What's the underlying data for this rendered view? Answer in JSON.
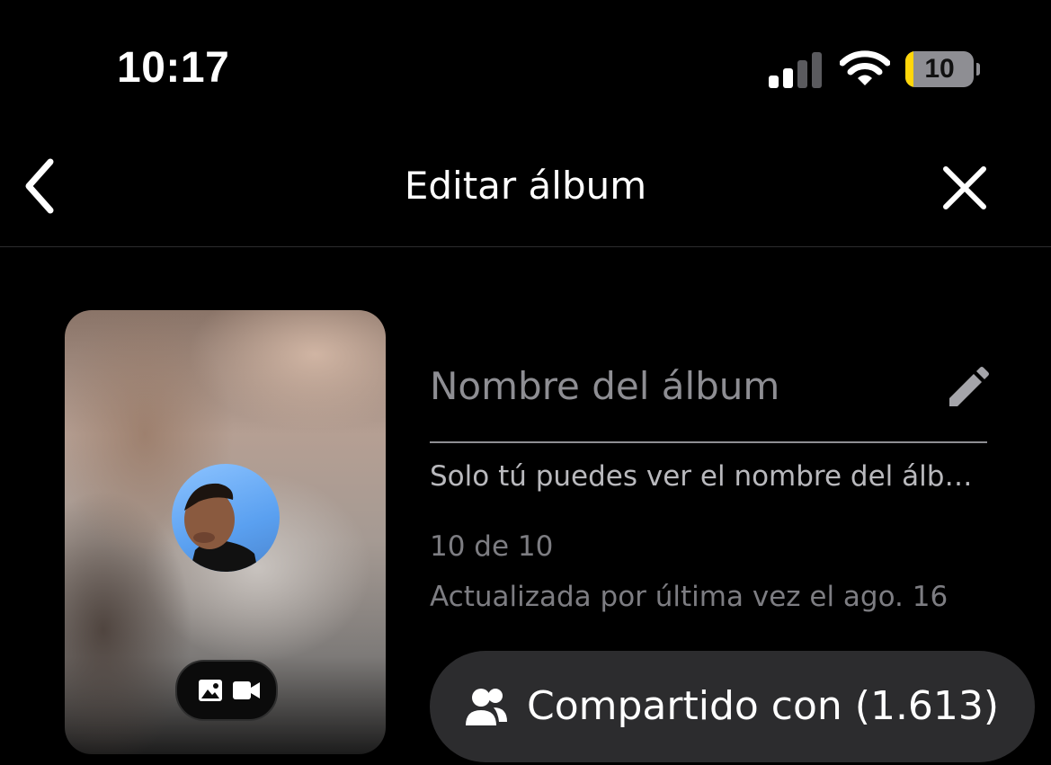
{
  "status_bar": {
    "time": "10:17",
    "battery_level": "10",
    "battery_fraction": 0.1,
    "battery_color": "#ffd60a",
    "icons": [
      "cellular-signal-icon",
      "wifi-icon",
      "battery-icon"
    ]
  },
  "nav": {
    "title": "Editar álbum",
    "back_icon": "chevron-left-icon",
    "close_icon": "close-icon"
  },
  "album": {
    "name_placeholder": "Nombre del álbum",
    "edit_icon": "pencil-icon",
    "privacy_note": "Solo tú puedes ver el nombre del álbum",
    "count": "10 de 10",
    "updated": "Actualizada por última vez el ago. 16"
  },
  "cover": {
    "media_icons": [
      "image-icon",
      "video-icon"
    ]
  },
  "share": {
    "label": "Compartido con (1.613)",
    "icon": "people-icon",
    "background": "#2c2c2e"
  }
}
